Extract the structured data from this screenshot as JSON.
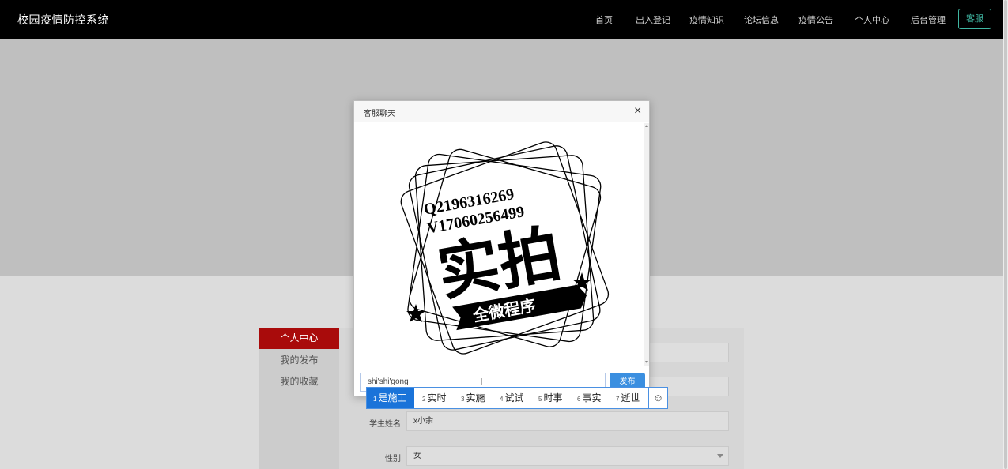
{
  "app": {
    "title": "校园疫情防控系统"
  },
  "nav": {
    "items": [
      "首页",
      "出入登记",
      "疫情知识",
      "论坛信息",
      "疫情公告",
      "个人中心",
      "后台管理"
    ],
    "cta": "客服"
  },
  "sidebar": {
    "items": [
      "个人中心",
      "我的发布",
      "我的收藏"
    ]
  },
  "form": {
    "name_label": "学生姓名",
    "name_value": "x小余",
    "gender_label": "性别",
    "gender_value": "女"
  },
  "dialog": {
    "title": "客服聊天",
    "close": "×",
    "input_value": "shi'shi'gong",
    "send_label": "发布",
    "image": {
      "line1": "Q2196316269",
      "line2": "V17060256499",
      "big_text": "实拍",
      "ribbon_text": "全微程序"
    }
  },
  "ime": {
    "candidates": [
      {
        "num": "1",
        "text": "是施工"
      },
      {
        "num": "2",
        "text": "实时"
      },
      {
        "num": "3",
        "text": "实施"
      },
      {
        "num": "4",
        "text": "试试"
      },
      {
        "num": "5",
        "text": "时事"
      },
      {
        "num": "6",
        "text": "事实"
      },
      {
        "num": "7",
        "text": "逝世"
      }
    ],
    "selected_index": 0,
    "emoji": "☺"
  },
  "colors": {
    "accent_nav_button": "#3fb6a2",
    "sidebar_active": "#a90b0b",
    "send_button": "#3b8fe0",
    "ime_selected": "#1a73d9"
  }
}
